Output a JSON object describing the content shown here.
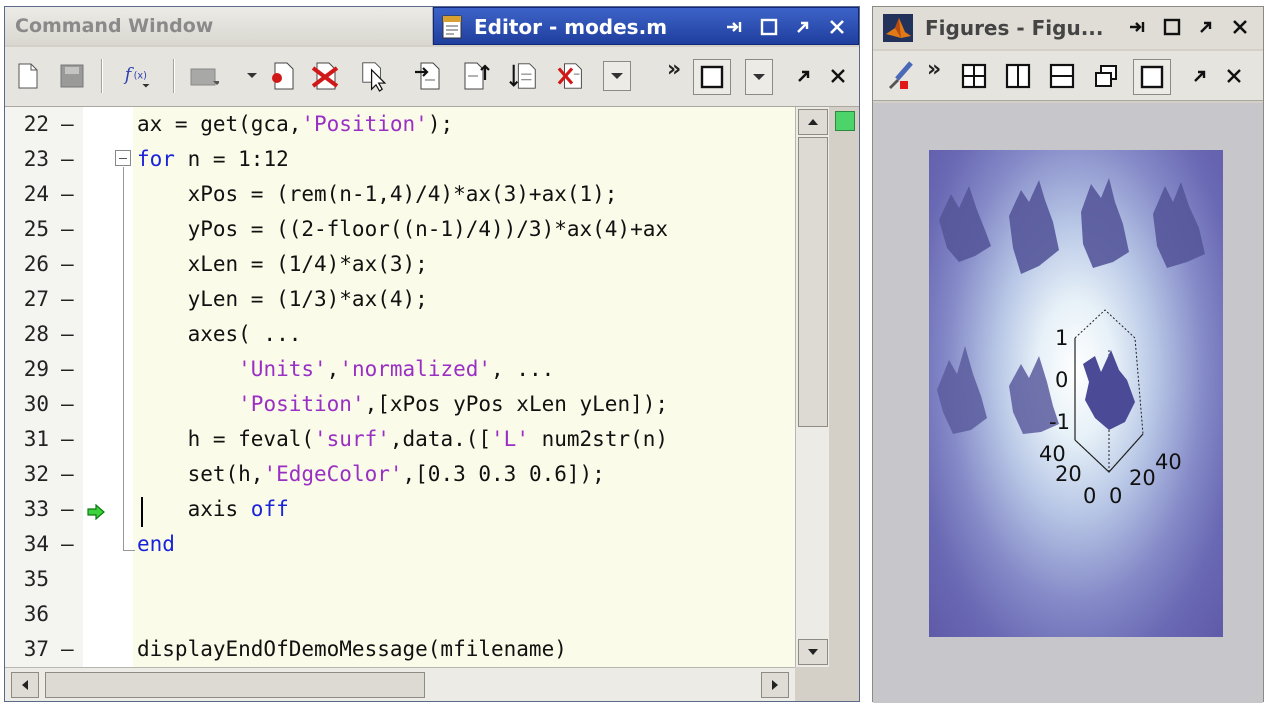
{
  "left": {
    "command_tab": "Command Window",
    "editor_tab": "Editor - modes.m"
  },
  "right": {
    "figures_title": "Figures - Figu..."
  },
  "code": {
    "lines": [
      {
        "n": "22",
        "text": "ax = get(gca,'Position');"
      },
      {
        "n": "23",
        "text": "for n = 1:12"
      },
      {
        "n": "24",
        "text": "    xPos = (rem(n-1,4)/4)*ax(3)+ax(1);"
      },
      {
        "n": "25",
        "text": "    yPos = ((2-floor((n-1)/4))/3)*ax(4)+ax"
      },
      {
        "n": "26",
        "text": "    xLen = (1/4)*ax(3);"
      },
      {
        "n": "27",
        "text": "    yLen = (1/3)*ax(4);"
      },
      {
        "n": "28",
        "text": "    axes( ..."
      },
      {
        "n": "29",
        "text": "        'Units','normalized', ..."
      },
      {
        "n": "30",
        "text": "        'Position',[xPos yPos xLen yLen]);"
      },
      {
        "n": "31",
        "text": "    h = feval('surf',data.(['L' num2str(n)"
      },
      {
        "n": "32",
        "text": "    set(h,'EdgeColor',[0.3 0.3 0.6]);"
      },
      {
        "n": "33",
        "text": "    axis off"
      },
      {
        "n": "34",
        "text": "end"
      },
      {
        "n": "35",
        "text": ""
      },
      {
        "n": "36",
        "text": ""
      },
      {
        "n": "37",
        "text": "displayEndOfDemoMessage(mfilename)"
      }
    ]
  },
  "plot": {
    "z_ticks": [
      "1",
      "0",
      "-1"
    ],
    "x_ticks": [
      "40",
      "20",
      "0"
    ],
    "y_ticks": [
      "0",
      "20",
      "40"
    ]
  },
  "colors": {
    "keyword": "#1a24d8",
    "string": "#9a2fc4",
    "active_tab": "#2a4db4"
  }
}
